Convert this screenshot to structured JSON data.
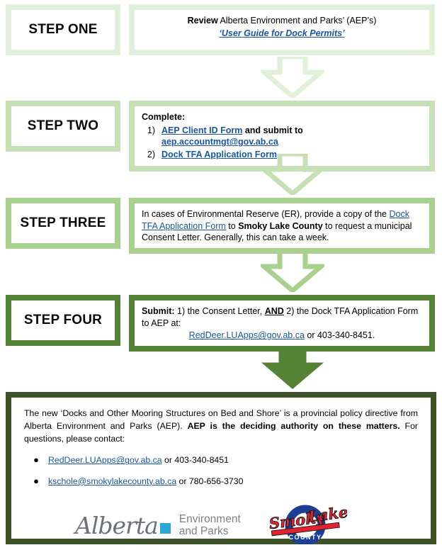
{
  "steps": [
    {
      "label": "STEP ONE",
      "accent": "#e2efd9",
      "line1_bold": "Review",
      "line1_rest": " Alberta Environment and Parks’ (AEP’s)",
      "link": "‘User Guide for Dock Permits’"
    },
    {
      "label": "STEP TWO",
      "accent": "#c5e0b4",
      "heading": "Complete:",
      "items": [
        {
          "num": "1)",
          "link": "AEP Client ID Form",
          "mid": " and submit to  ",
          "email": "aep.accountmgt@gov.ab.ca"
        },
        {
          "num": "2)",
          "link": "Dock TFA Application Form",
          "mid": "",
          "email": ""
        }
      ]
    },
    {
      "label": "STEP THREE",
      "accent": "#a9d18e",
      "t1": "In cases of Environmental Reserve (ER), provide a copy of the ",
      "link": "Dock TFA Application Form",
      "t2": " to ",
      "bold": "Smoky Lake County",
      "t3": " to request a municipal Consent Letter. Generally, this can take a week."
    },
    {
      "label": "STEP FOUR",
      "accent": "#548235",
      "bold1": "Submit:",
      "t1": " 1) the Consent Letter, ",
      "bold_u": "AND",
      "t2": " 2) the Dock TFA Application Form to AEP at:",
      "email": "RedDeer.LUApps@gov.ab.ca",
      "t3": " or 403-340-8451."
    }
  ],
  "arrows": [
    {
      "name": "arrow-step-one-to-two",
      "color": "#e2efd9"
    },
    {
      "name": "arrow-step-two-to-three",
      "color": "#c5e0b4"
    },
    {
      "name": "arrow-step-three-to-four",
      "color": "#a9d18e"
    },
    {
      "name": "arrow-step-four-to-note",
      "color": "#548235"
    }
  ],
  "bottom": {
    "border_color": "#3d5229",
    "para_t1": "The new ‘Docks and Other Mooring Structures on Bed and Shore’ is a provincial policy directive from Alberta Environment and Parks (AEP). ",
    "para_bold": "AEP is the deciding authority on these matters.",
    "para_t2": " For questions, please contact:",
    "contacts": [
      {
        "email": "RedDeer.LUApps@gov.ab.ca",
        "rest": " or 403-340-8451"
      },
      {
        "email": "kschole@smokylakecounty.ab.ca",
        "rest": " or 780-656-3730"
      }
    ]
  },
  "logos": {
    "alberta": {
      "wordmark": "Alberta",
      "sub_line1": "Environment",
      "sub_line2": "and Parks",
      "square_color": "#2ba6d8",
      "text_color": "#6b7177"
    },
    "smoky": {
      "word1": "Smoky",
      "word2": "Lake",
      "word3": "COUNTY",
      "ring_color": "#1c3f94",
      "script_color": "#e0232e"
    }
  },
  "link_color": "#1a55a8"
}
